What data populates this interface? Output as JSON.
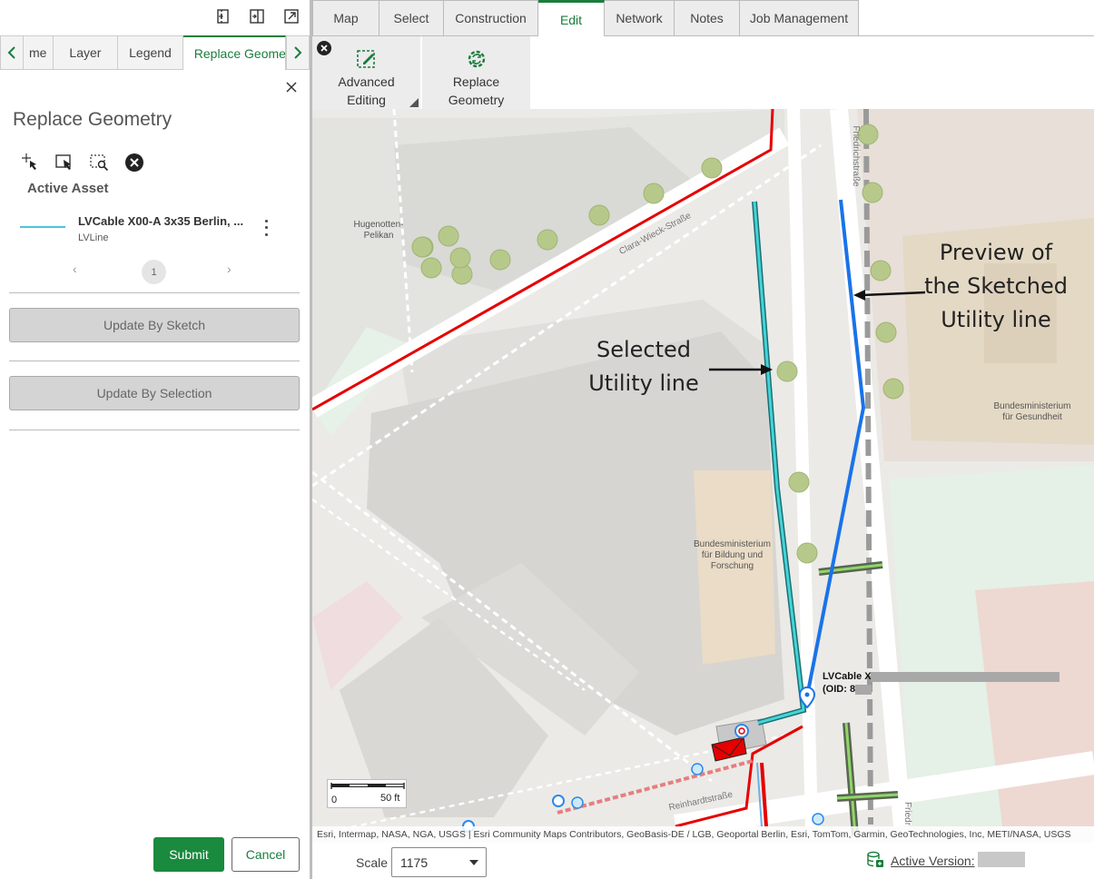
{
  "left_panel": {
    "tabs": [
      {
        "label": "me"
      },
      {
        "label": "Layer"
      },
      {
        "label": "Legend"
      },
      {
        "label": "Replace Geometry"
      }
    ],
    "title": "Replace Geometry",
    "active_asset_label": "Active Asset",
    "asset": {
      "name": "LVCable X00-A 3x35 Berlin, ...",
      "type": "LVLine",
      "line_color": "#4fc4d6"
    },
    "pager": {
      "prev": "‹",
      "page": "1",
      "next": "›"
    },
    "update_by_sketch": "Update By Sketch",
    "update_by_selection": "Update By Selection",
    "submit": "Submit",
    "cancel": "Cancel"
  },
  "ribbon": {
    "tabs": [
      {
        "label": "Map"
      },
      {
        "label": "Select"
      },
      {
        "label": "Construction"
      },
      {
        "label": "Edit"
      },
      {
        "label": "Network"
      },
      {
        "label": "Notes"
      },
      {
        "label": "Job Management"
      }
    ],
    "active_tab": "Edit",
    "advanced_editing": "Advanced Editing",
    "replace_geometry": "Replace Geometry"
  },
  "map": {
    "labels": {
      "hugenotten": "Hugenotten-\nPelikan",
      "clara_street": "Clara-Wieck-Straße",
      "friedrich_street": "Friedrichstraße",
      "reinhardt_street": "Reinhardtstraße",
      "friedr_bottom": "Friedr",
      "bmg": "Bundesministerium\nfür Gesundheit",
      "bmbf": "Bundesministerium\nfür Bildung und\nForschung"
    },
    "annotations": {
      "selected": "Selected\nUtility line",
      "preview": "Preview of\nthe Sketched\nUtility line"
    },
    "callout": {
      "line1": "LVCable X",
      "line2": "(OID: 8"
    },
    "scale_bar": {
      "start": "0",
      "end": "50 ft"
    },
    "attribution": "Esri, Intermap, NASA, NGA, USGS | Esri Community Maps Contributors, GeoBasis-DE / LGB, Geoportal Berlin, Esri, TomTom, Garmin, GeoTechnologies, Inc, METI/NASA, USGS",
    "colors": {
      "selected_line": "#2ec4c4",
      "preview_line": "#1a73e8",
      "boundary": "#e60000"
    }
  },
  "bottom_bar": {
    "scale_label": "Scale",
    "scale_value": "1175",
    "active_version_label": "Active Version:"
  },
  "colors": {
    "accent": "#1a7d3d",
    "submit_bg": "#1a8a3e"
  }
}
